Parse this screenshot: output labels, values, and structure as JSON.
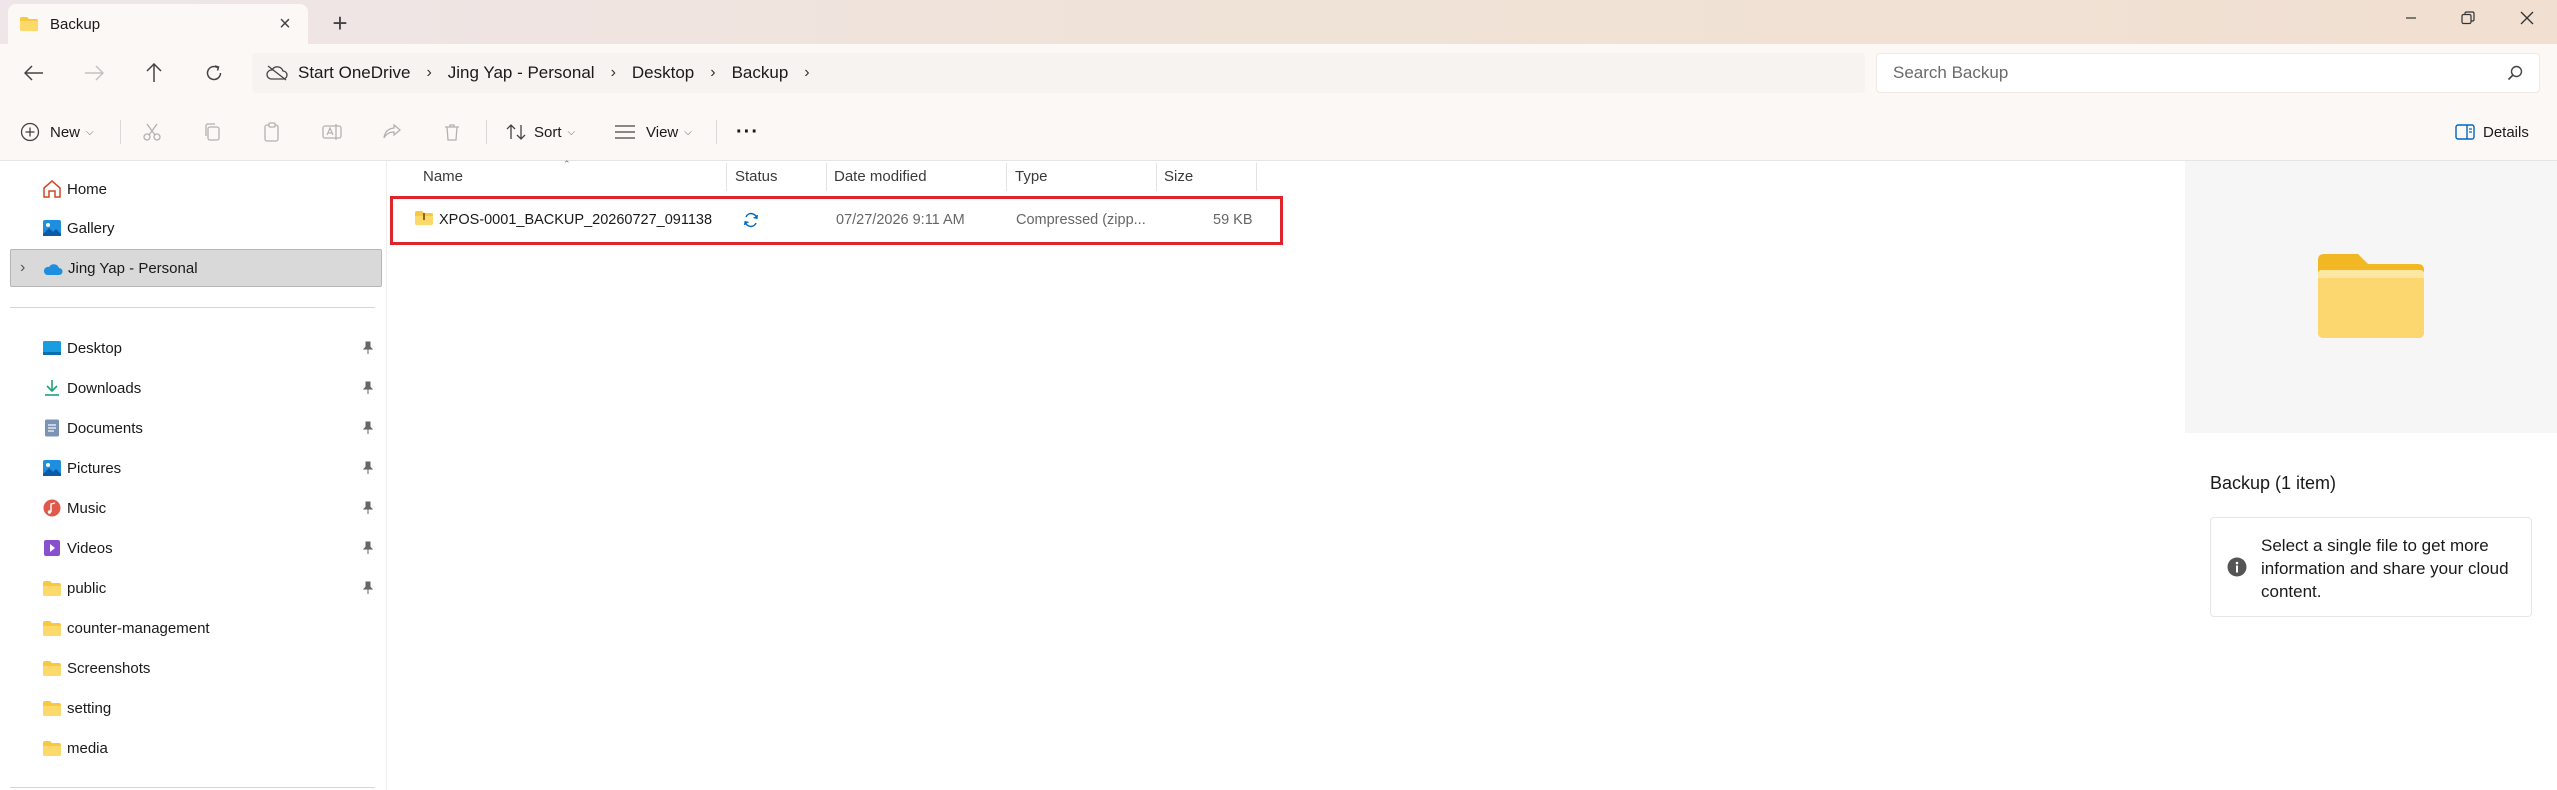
{
  "window": {
    "tab_title": "Backup",
    "new_tab_symbol": "+",
    "close_tab_symbol": "×",
    "controls": [
      "minimize-icon",
      "restore-icon",
      "close-icon"
    ]
  },
  "address": {
    "breadcrumbs": [
      "Start OneDrive",
      "Jing Yap - Personal",
      "Desktop",
      "Backup"
    ],
    "search_placeholder": "Search Backup"
  },
  "toolbar": {
    "new_label": "New",
    "sort_label": "Sort",
    "view_label": "View",
    "more_label": "···",
    "details_label": "Details",
    "disabled_actions": [
      "cut-icon",
      "copy-icon",
      "paste-icon",
      "rename-icon",
      "share-icon",
      "delete-icon"
    ]
  },
  "sidebar": {
    "top": [
      {
        "label": "Home",
        "icon": "home-icon"
      },
      {
        "label": "Gallery",
        "icon": "gallery-icon"
      },
      {
        "label": "Jing Yap - Personal",
        "icon": "onedrive-cloud-icon",
        "selected": true
      }
    ],
    "pinned": [
      {
        "label": "Desktop",
        "icon": "desktop-icon",
        "pinned": true
      },
      {
        "label": "Downloads",
        "icon": "downloads-icon",
        "pinned": true
      },
      {
        "label": "Documents",
        "icon": "documents-icon",
        "pinned": true
      },
      {
        "label": "Pictures",
        "icon": "pictures-icon",
        "pinned": true
      },
      {
        "label": "Music",
        "icon": "music-icon",
        "pinned": true
      },
      {
        "label": "Videos",
        "icon": "videos-icon",
        "pinned": true
      },
      {
        "label": "public",
        "icon": "folder-icon",
        "pinned": true
      },
      {
        "label": "counter-management",
        "icon": "folder-icon",
        "pinned": false
      },
      {
        "label": "Screenshots",
        "icon": "folder-icon",
        "pinned": false
      },
      {
        "label": "setting",
        "icon": "folder-icon",
        "pinned": false
      },
      {
        "label": "media",
        "icon": "folder-icon",
        "pinned": false
      }
    ]
  },
  "file_list": {
    "columns": [
      "Name",
      "Status",
      "Date modified",
      "Type",
      "Size"
    ],
    "rows": [
      {
        "name": "XPOS-0001_BACKUP_20260727_091138",
        "status_icon": "sync-icon",
        "date_modified": "07/27/2026 9:11 AM",
        "type": "Compressed (zipp...",
        "size": "59 KB"
      }
    ]
  },
  "details_pane": {
    "title": "Backup (1 item)",
    "info_message": "Select a single file to get more information and share your cloud content."
  },
  "colors": {
    "accent_blue": "#0067c0",
    "folder_yellow": "#f8c93e",
    "highlight_red": "#e0242b",
    "onedrive_blue": "#1e8fe0"
  }
}
